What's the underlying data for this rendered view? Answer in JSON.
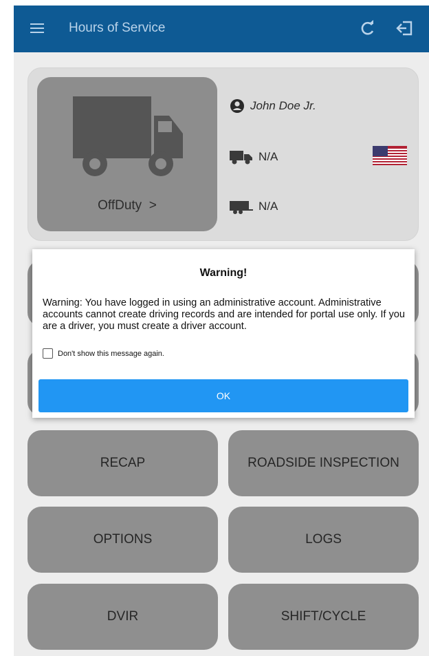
{
  "appbar": {
    "title": "Hours of Service",
    "icons": [
      "menu-icon",
      "refresh-icon",
      "logout-icon"
    ]
  },
  "status_card": {
    "duty_status": "OffDuty",
    "chevron": ">",
    "driver_name": "John Doe Jr.",
    "vehicle": "N/A",
    "trailer": "N/A",
    "country_flag": "us-flag-icon"
  },
  "buttons": {
    "recap": "RECAP",
    "roadside_inspection": "ROADSIDE INSPECTION",
    "options": "OPTIONS",
    "logs": "LOGS",
    "dvir": "DVIR",
    "shift_cycle": "SHIFT/CYCLE"
  },
  "dialog": {
    "title": "Warning!",
    "message": "Warning: You have logged in using an administrative account. Administrative accounts cannot create driving records and are intended for portal use only. If you are a driver, you must create a driver account.",
    "checkbox_label": "Don't show this message again.",
    "ok_label": "OK"
  },
  "colors": {
    "appbar": "#0e5a94",
    "ok_button": "#2196f3",
    "dim_button": "#8f8f8f"
  }
}
